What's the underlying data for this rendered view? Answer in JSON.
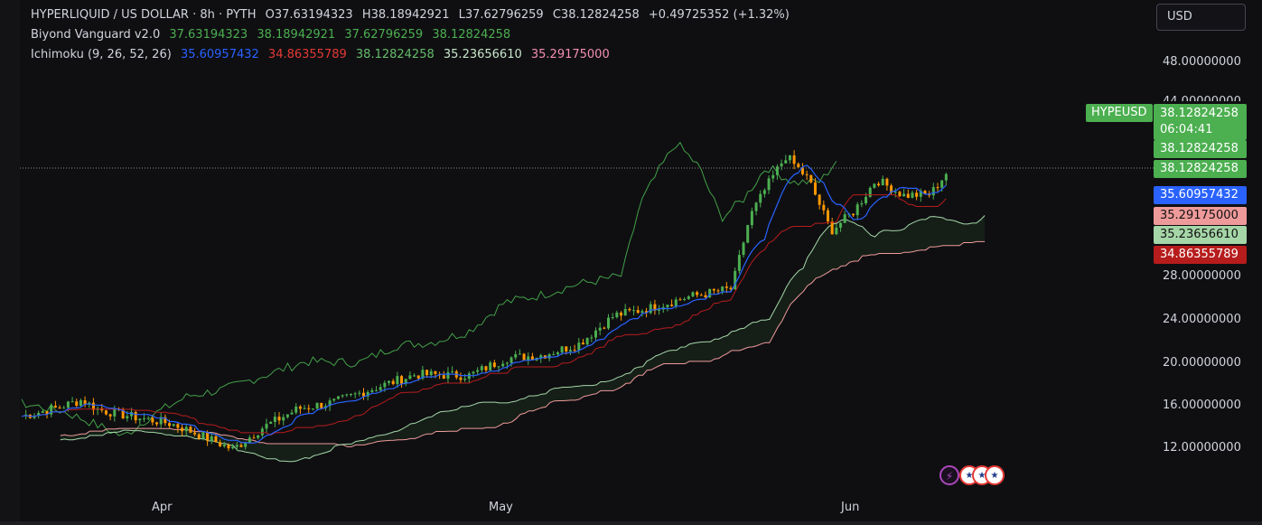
{
  "legend": {
    "symbol": "HYPERLIQUID / US DOLLAR · 8h · PYTH",
    "ohlc": [
      {
        "k": "O",
        "v": "37.63194323"
      },
      {
        "k": "H",
        "v": "38.18942921"
      },
      {
        "k": "L",
        "v": "37.62796259"
      },
      {
        "k": "C",
        "v": "38.12824258"
      }
    ],
    "change": "+0.49725352 (+1.32%)",
    "ind1_name": "Biyond Vanguard v2.0",
    "ind1_values": [
      "37.63194323",
      "38.18942921",
      "37.62796259",
      "38.12824258"
    ],
    "ind2_name": "Ichimoku (9, 26, 52, 26)",
    "ind2_values": [
      "35.60957432",
      "34.86355789",
      "38.12824258",
      "35.23656610",
      "35.29175000"
    ]
  },
  "currency": "USD",
  "price_axis": [
    "48.00000000",
    "44.00000000",
    "28.00000000",
    "24.00000000",
    "20.00000000",
    "16.00000000",
    "12.00000000"
  ],
  "time_axis": [
    "Apr",
    "May",
    "Jun"
  ],
  "tags": {
    "symbol": "HYPEUSD",
    "last": "38.12824258",
    "countdown": "06:04:41",
    "tag2": "38.12824258",
    "tag3": "38.12824258",
    "conversion": "35.60957432",
    "lead_b": "35.29175000",
    "lead_a": "35.23656610",
    "base": "34.86355789"
  },
  "colors": {
    "background": "#0f0f12",
    "up": "#4caf50",
    "down": "#ff9800",
    "conversion": "#2962ff",
    "base": "#b71c1c",
    "lagging": "#43a047",
    "lead_a": "#a5d6a7",
    "lead_b": "#ef9a9a"
  },
  "events": [
    "lightning-icon",
    "us-flag-icon",
    "us-flag-icon",
    "us-flag-icon"
  ]
}
